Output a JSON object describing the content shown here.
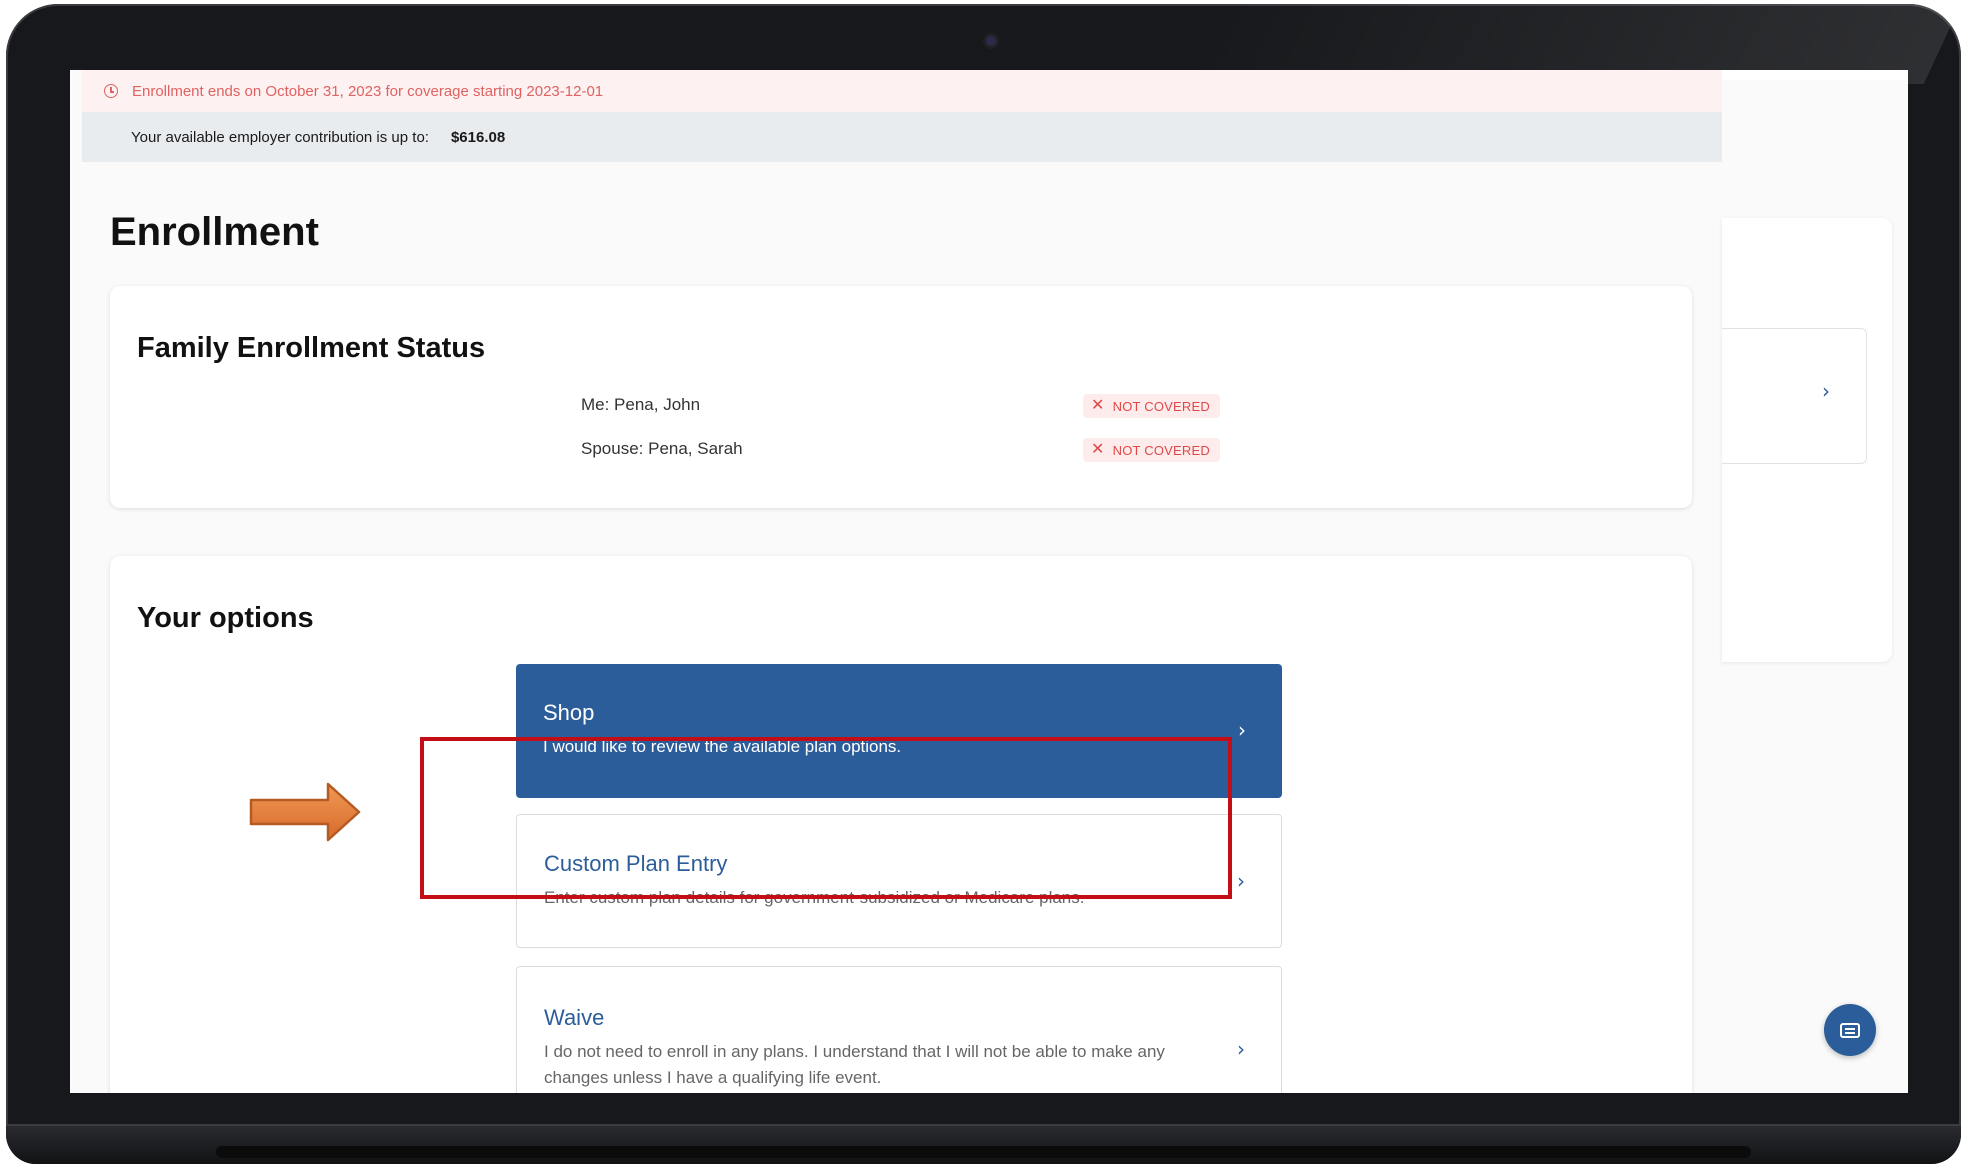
{
  "alert": {
    "text": "Enrollment ends on October 31, 2023 for coverage starting 2023-12-01",
    "icon": "clock-icon",
    "color": "#e06262"
  },
  "contribution": {
    "label": "Your available employer contribution is up to:",
    "amount": "$616.08"
  },
  "page": {
    "title": "Enrollment"
  },
  "family": {
    "title": "Family Enrollment Status",
    "members": [
      {
        "name": "Me: Pena, John",
        "status": "NOT COVERED"
      },
      {
        "name": "Spouse: Pena, Sarah",
        "status": "NOT COVERED"
      }
    ],
    "status_color": "#e04848"
  },
  "options": {
    "title": "Your options",
    "items": [
      {
        "title": "Shop",
        "description": "I would like to review the available plan options."
      },
      {
        "title": "Custom Plan Entry",
        "description": "Enter custom plan details for government-subsidized or Medicare plans."
      },
      {
        "title": "Waive",
        "description": "I do not need to enroll in any plans. I understand that I will not be able to make any changes unless I have a qualifying life event."
      }
    ]
  },
  "colors": {
    "accent": "#2c5d9b",
    "highlight": "#c40e17",
    "arrow": "#e07b34"
  },
  "icons": {
    "chevron": "›",
    "close": "✕",
    "chat": "chat-icon"
  }
}
